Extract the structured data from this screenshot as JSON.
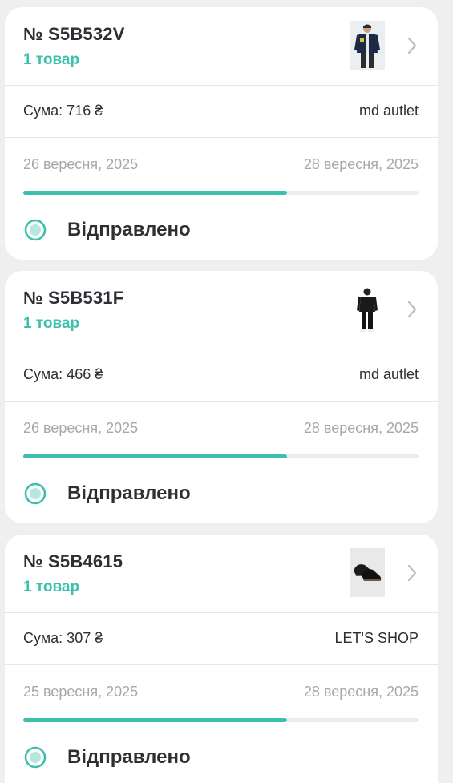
{
  "orders": [
    {
      "number": "№ S5B532V",
      "item_count": "1 товар",
      "thumbnail": "jacket-photo",
      "sum": "Сума: 716 ₴",
      "seller": "md autlet",
      "date_start": "26 вересня, 2025",
      "date_end": "28 вересня, 2025",
      "progress": 0.667,
      "status": "Відправлено"
    },
    {
      "number": "№ S5B531F",
      "item_count": "1 товар",
      "thumbnail": "tracksuit-photo",
      "sum": "Сума: 466 ₴",
      "seller": "md autlet",
      "date_start": "26 вересня, 2025",
      "date_end": "28 вересня, 2025",
      "progress": 0.667,
      "status": "Відправлено"
    },
    {
      "number": "№ S5B4615",
      "item_count": "1 товар",
      "thumbnail": "shoes-photo",
      "sum": "Сума: 307 ₴",
      "seller": "LET'S SHOP",
      "date_start": "25 вересня, 2025",
      "date_end": "28 вересня, 2025",
      "progress": 0.667,
      "status": "Відправлено"
    }
  ],
  "colors": {
    "accent": "#3cc0ad",
    "background": "#efefef",
    "card": "#ffffff",
    "muted_text": "#a8a8a8"
  },
  "icons": {
    "chevron": "chevron-right-icon",
    "status": "status-dot-icon"
  }
}
